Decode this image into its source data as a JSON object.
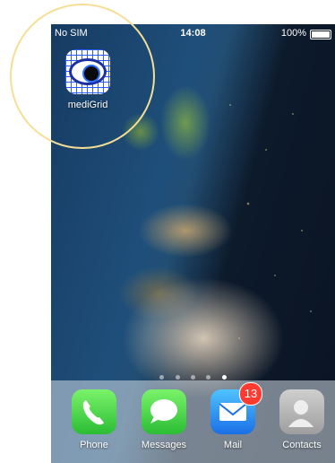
{
  "status_bar": {
    "carrier": "No SIM",
    "time": "14:08",
    "battery": "100%"
  },
  "home_apps": [
    {
      "label": "mediGrid",
      "icon": "medigrid-eye-icon"
    }
  ],
  "page_indicator": {
    "pages": 5,
    "current": 5
  },
  "dock": [
    {
      "label": "Phone",
      "icon": "phone-icon"
    },
    {
      "label": "Messages",
      "icon": "messages-icon"
    },
    {
      "label": "Mail",
      "icon": "mail-icon",
      "badge": "13"
    },
    {
      "label": "Contacts",
      "icon": "contacts-icon"
    }
  ],
  "colors": {
    "badge": "#ff3b30",
    "highlight_ring": "#f5de96"
  }
}
